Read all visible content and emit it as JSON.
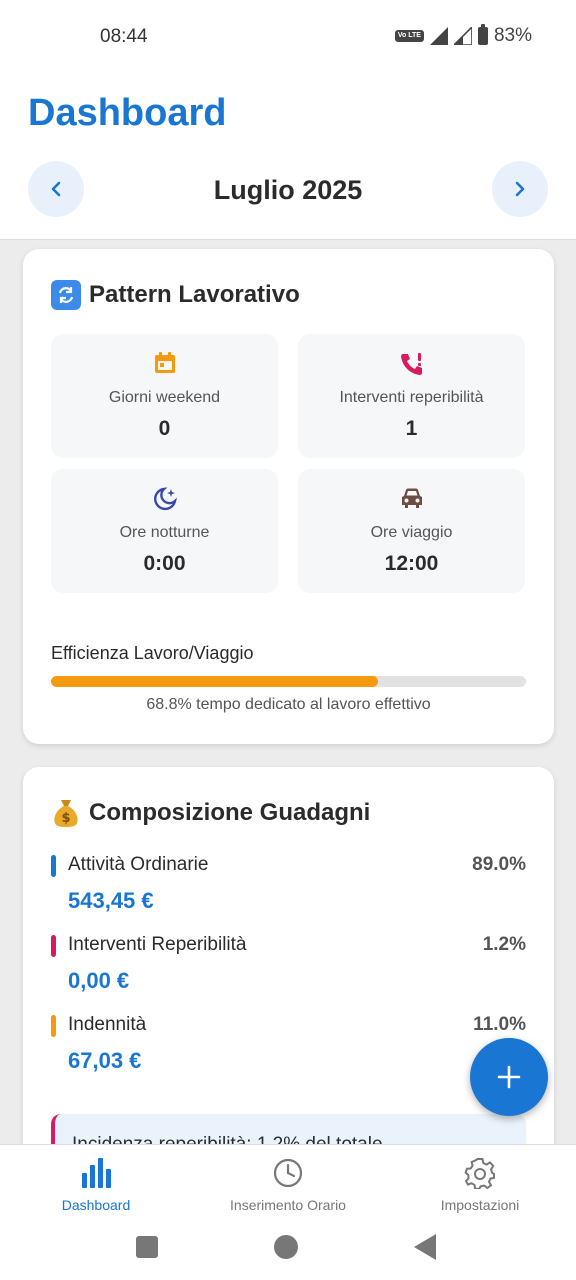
{
  "status_bar": {
    "time": "08:44",
    "volte": "Vo LTE",
    "battery": "83%"
  },
  "header": {
    "title": "Dashboard",
    "month": "Luglio 2025"
  },
  "pattern": {
    "emoji": "🔄",
    "title": "Pattern Lavorativo",
    "stats": [
      {
        "label": "Giorni weekend",
        "value": "0",
        "icon": "calendar-icon",
        "color": "#f59a0c"
      },
      {
        "label": "Interventi reperibilità",
        "value": "1",
        "icon": "phone-alert-icon",
        "color": "#d81b60"
      },
      {
        "label": "Ore notturne",
        "value": "0:00",
        "icon": "moon-star-icon",
        "color": "#3949ab"
      },
      {
        "label": "Ore viaggio",
        "value": "12:00",
        "icon": "car-icon",
        "color": "#6d4c41"
      }
    ],
    "efficiency_label": "Efficienza Lavoro/Viaggio",
    "efficiency_percent": 68.8,
    "efficiency_note": "68.8% tempo dedicato al lavoro effettivo"
  },
  "earnings": {
    "emoji": "💰",
    "title": "Composizione Guadagni",
    "rows": [
      {
        "name": "Attività Ordinarie",
        "percent": "89.0%",
        "amount": "543,45 €",
        "color": "#1976d2"
      },
      {
        "name": "Interventi Reperibilità",
        "percent": "1.2%",
        "amount": "0,00 €",
        "color": "#d81b60"
      },
      {
        "name": "Indennità",
        "percent": "11.0%",
        "amount": "67,03 €",
        "color": "#f59a0c"
      }
    ],
    "insight": "Incidenza reperibilità: 1.2% del totale"
  },
  "bottom_nav": [
    {
      "label": "Dashboard",
      "active": true
    },
    {
      "label": "Inserimento Orario",
      "active": false
    },
    {
      "label": "Impostazioni",
      "active": false
    }
  ]
}
